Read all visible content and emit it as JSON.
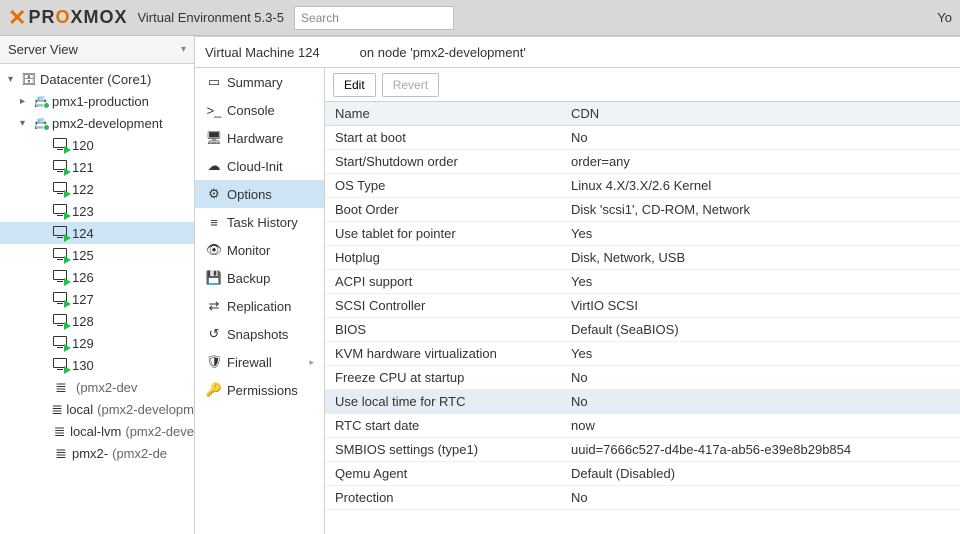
{
  "header": {
    "brand_prefix": "PR",
    "brand_o": "O",
    "brand_suffix": "XMOX",
    "env_label": "Virtual Environment 5.3-5",
    "search_placeholder": "Search",
    "right_text": "Yo"
  },
  "sidebar": {
    "view_label": "Server View",
    "datacenter": "Datacenter (Core1)",
    "nodes": [
      {
        "name": "pmx1-production",
        "expanded": false
      },
      {
        "name": "pmx2-development",
        "expanded": true
      }
    ],
    "vms": [
      "120",
      "121",
      "122",
      "123",
      "124",
      "125",
      "126",
      "127",
      "128",
      "129",
      "130"
    ],
    "selected_vm": "124",
    "storages": [
      {
        "name": "",
        "suffix": "(pmx2-dev"
      },
      {
        "name": "local",
        "suffix": "(pmx2-developm"
      },
      {
        "name": "local-lvm",
        "suffix": "(pmx2-deve"
      },
      {
        "name": "pmx2-",
        "suffix": "(pmx2-de"
      }
    ]
  },
  "content": {
    "title": "Virtual Machine 124",
    "node_text": "on node 'pmx2-development'",
    "subnav": [
      {
        "icon": "summary",
        "label": "Summary"
      },
      {
        "icon": "console",
        "label": "Console"
      },
      {
        "icon": "hardware",
        "label": "Hardware"
      },
      {
        "icon": "cloud",
        "label": "Cloud-Init"
      },
      {
        "icon": "options",
        "label": "Options",
        "selected": true
      },
      {
        "icon": "history",
        "label": "Task History"
      },
      {
        "icon": "monitor",
        "label": "Monitor"
      },
      {
        "icon": "backup",
        "label": "Backup"
      },
      {
        "icon": "replication",
        "label": "Replication"
      },
      {
        "icon": "snapshots",
        "label": "Snapshots"
      },
      {
        "icon": "firewall",
        "label": "Firewall",
        "arrow": true
      },
      {
        "icon": "permissions",
        "label": "Permissions"
      }
    ],
    "toolbar": {
      "edit": "Edit",
      "revert": "Revert"
    },
    "grid_headers": {
      "name": "Name",
      "value": "CDN"
    },
    "options": [
      {
        "name": "Start at boot",
        "value": "No"
      },
      {
        "name": "Start/Shutdown order",
        "value": "order=any"
      },
      {
        "name": "OS Type",
        "value": "Linux 4.X/3.X/2.6 Kernel"
      },
      {
        "name": "Boot Order",
        "value": "Disk 'scsi1', CD-ROM, Network"
      },
      {
        "name": "Use tablet for pointer",
        "value": "Yes"
      },
      {
        "name": "Hotplug",
        "value": "Disk, Network, USB"
      },
      {
        "name": "ACPI support",
        "value": "Yes"
      },
      {
        "name": "SCSI Controller",
        "value": "VirtIO SCSI"
      },
      {
        "name": "BIOS",
        "value": "Default (SeaBIOS)"
      },
      {
        "name": "KVM hardware virtualization",
        "value": "Yes"
      },
      {
        "name": "Freeze CPU at startup",
        "value": "No"
      },
      {
        "name": "Use local time for RTC",
        "value": "No",
        "selected": true
      },
      {
        "name": "RTC start date",
        "value": "now"
      },
      {
        "name": "SMBIOS settings (type1)",
        "value": "uuid=7666c527-d4be-417a-ab56-e39e8b29b854"
      },
      {
        "name": "Qemu Agent",
        "value": "Default (Disabled)"
      },
      {
        "name": "Protection",
        "value": "No"
      }
    ]
  }
}
